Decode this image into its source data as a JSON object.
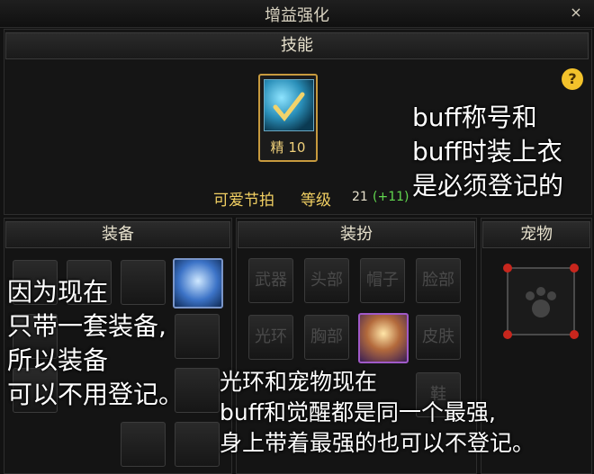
{
  "window": {
    "title": "增益强化",
    "close_glyph": "×"
  },
  "skill_section": {
    "header": "技能",
    "icon_name": "skill-icon",
    "icon_badge": "精",
    "icon_level": "10",
    "skill_name": "可爱节拍",
    "level_label": "等级",
    "level_value": "21",
    "level_bonus": "(+11)",
    "help_glyph": "?"
  },
  "notes": {
    "top_right_line1": "buff称号和",
    "top_right_line2": "buff时装上衣",
    "top_right_line3": "是必须登记的",
    "left_line1": "因为现在",
    "left_line2": "只带一套装备,",
    "left_line3": "所以装备",
    "left_line4": "可以不用登记。",
    "bottom_line1": "光环和宠物现在",
    "bottom_line2": "buff和觉醒都是同一个最强,",
    "bottom_line3": "身上带着最强的也可以不登记。"
  },
  "equipment": {
    "header": "装备"
  },
  "costume": {
    "header": "装扮",
    "slots": [
      "武器",
      "头部",
      "帽子",
      "脸部",
      "光环",
      "胸部",
      "皮肤",
      "鞋"
    ]
  },
  "pet": {
    "header": "宠物"
  },
  "colors": {
    "accent_gold": "#c79a3e",
    "level_green": "#62d84f",
    "skill_name_yellow": "#f1cf62",
    "help_yellow": "#f3c22b"
  }
}
